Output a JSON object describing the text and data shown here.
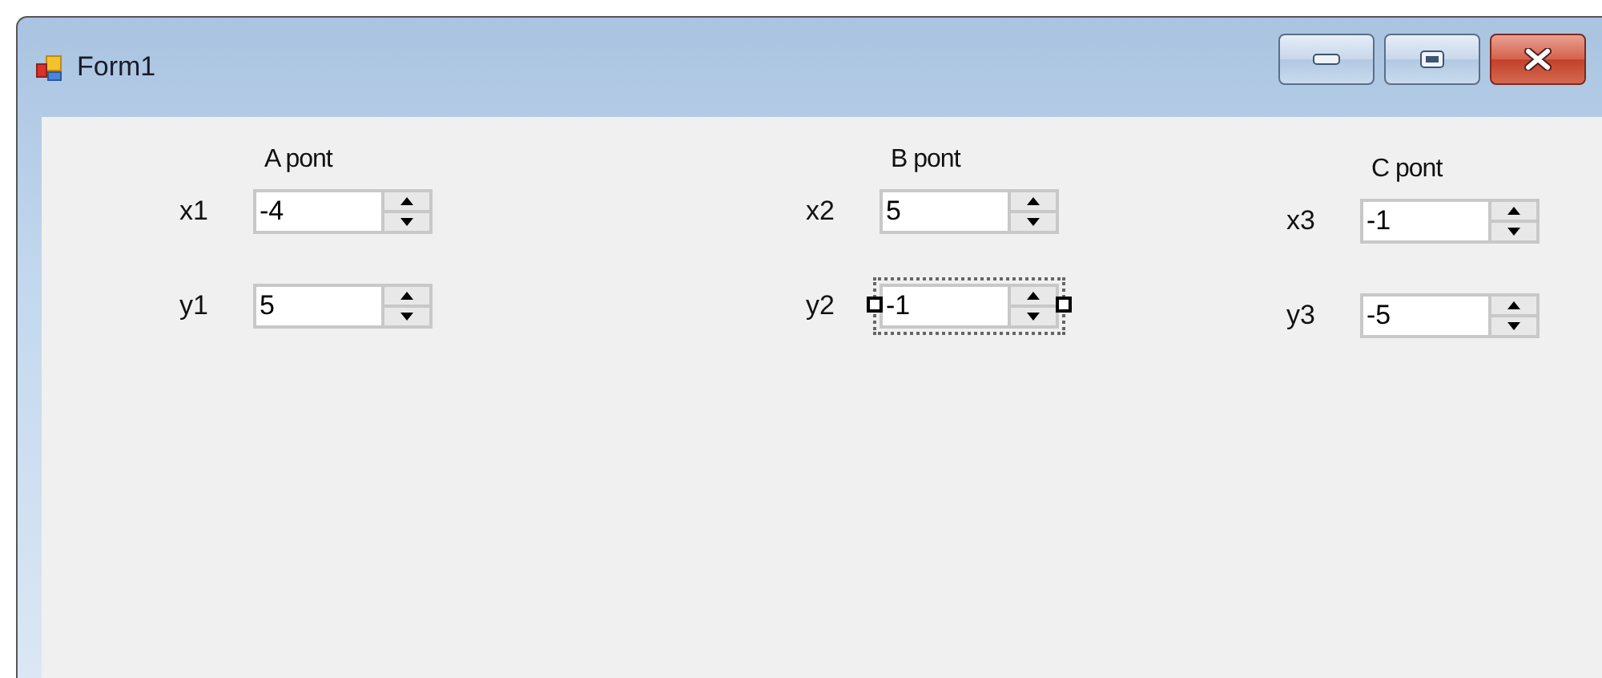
{
  "window": {
    "title": "Form1"
  },
  "groups": [
    {
      "title": "A pont",
      "fields": [
        {
          "label": "x1",
          "value": "-4",
          "selected": false
        },
        {
          "label": "y1",
          "value": "5",
          "selected": false
        }
      ]
    },
    {
      "title": "B pont",
      "fields": [
        {
          "label": "x2",
          "value": "5",
          "selected": false
        },
        {
          "label": "y2",
          "value": "-1",
          "selected": true
        }
      ]
    },
    {
      "title": "C pont",
      "fields": [
        {
          "label": "x3",
          "value": "-1",
          "selected": false
        },
        {
          "label": "y3",
          "value": "-5",
          "selected": false
        }
      ]
    }
  ]
}
